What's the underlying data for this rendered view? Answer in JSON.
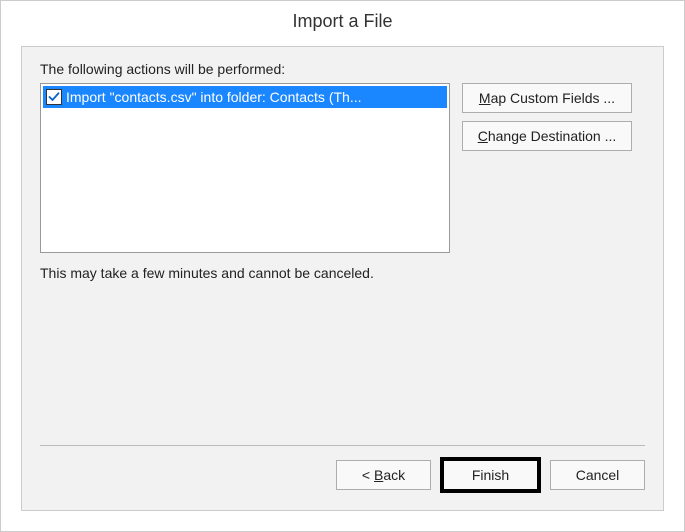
{
  "window": {
    "title": "Import a File"
  },
  "main": {
    "actions_label": "The following actions will be performed:",
    "list_item": {
      "checked": true,
      "text": "Import \"contacts.csv\" into folder: Contacts (Th..."
    },
    "note": "This may take a few minutes and cannot be canceled."
  },
  "side": {
    "map_fields": {
      "prefix": "",
      "accel": "M",
      "suffix": "ap Custom Fields ..."
    },
    "change_dest": {
      "prefix": "",
      "accel": "C",
      "suffix": "hange Destination ..."
    }
  },
  "footer": {
    "back": {
      "prefix": "< ",
      "accel": "B",
      "suffix": "ack"
    },
    "finish": "Finish",
    "cancel": "Cancel"
  }
}
